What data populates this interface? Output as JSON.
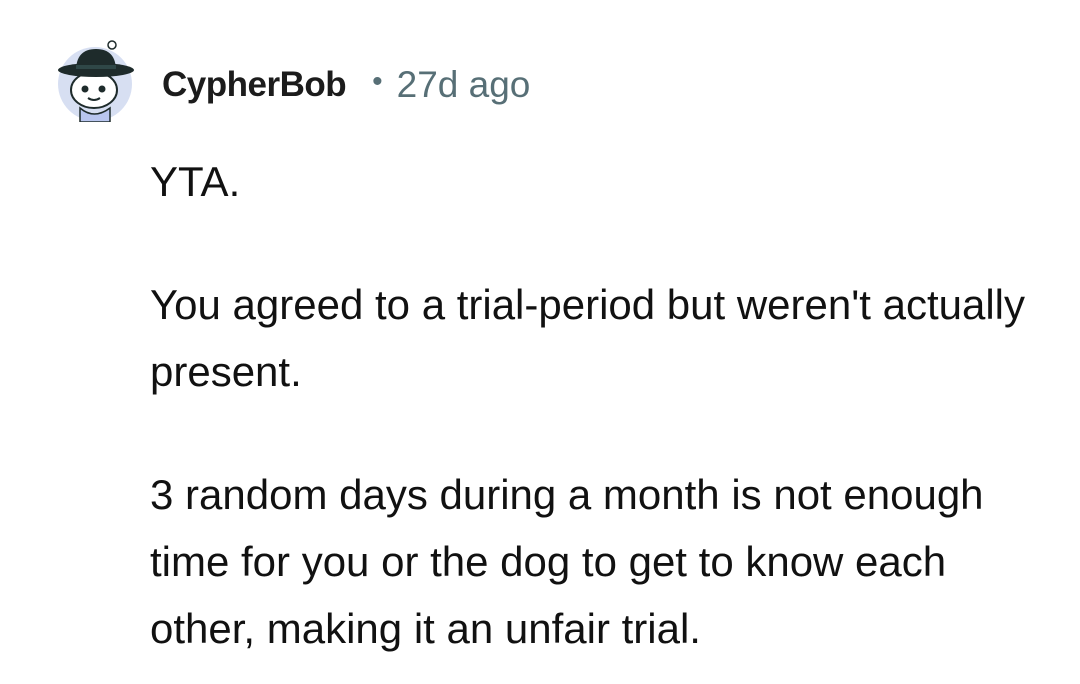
{
  "comment": {
    "author": "CypherBob",
    "separator": "•",
    "age": "27d ago",
    "avatar_icon": "snoo-avatar-icon",
    "paragraphs": [
      "YTA.",
      "You agreed to a trial-period but weren't actually present.",
      "3 random days during a month is not enough time for you or the dog to get to know each other, making it an unfair trial."
    ]
  },
  "colors": {
    "text": "#1c1c1c",
    "meta": "#576f76",
    "avatar_bg": "#d7dff2",
    "hat": "#1e2b2b"
  }
}
